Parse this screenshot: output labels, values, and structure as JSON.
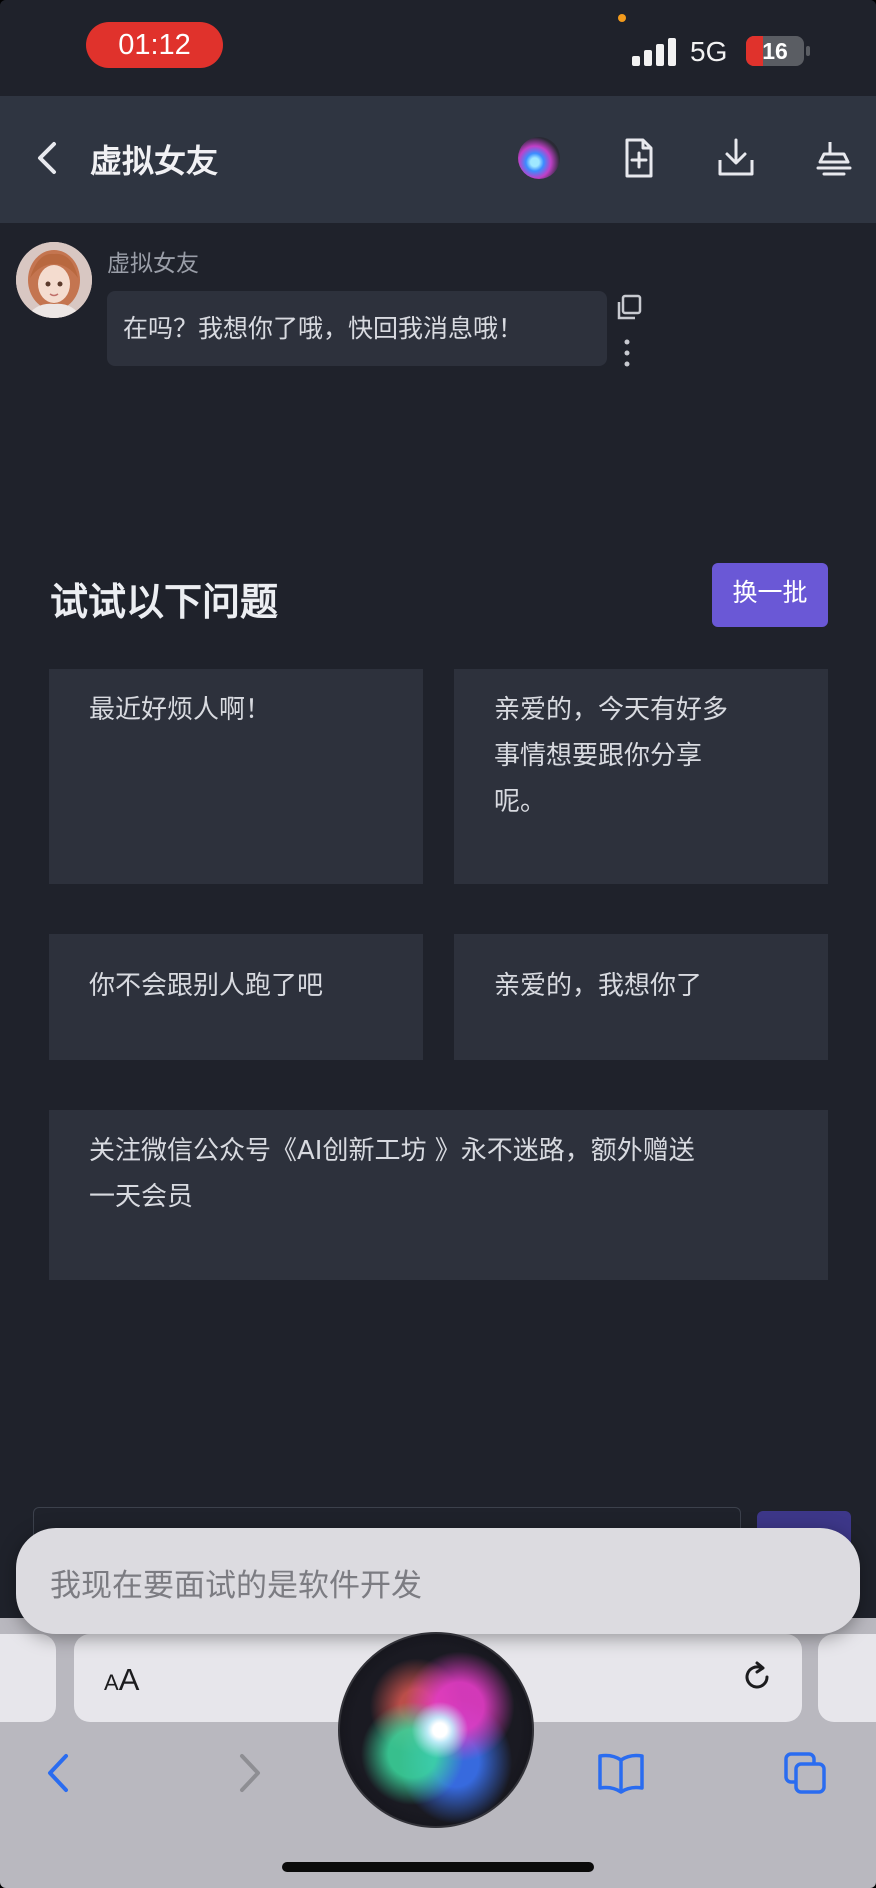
{
  "status_bar": {
    "time": "01:12",
    "network": "5G",
    "battery": "16",
    "battery_level_percent": 16,
    "recording_indicator_color": "#f29a1c"
  },
  "header": {
    "title": "虚拟女友",
    "icons": [
      "back-arrow-icon",
      "siri-icon",
      "new-file-icon",
      "download-icon",
      "clear-icon"
    ]
  },
  "chat": {
    "messages": [
      {
        "sender": "虚拟女友",
        "text": "在吗？我想你了哦，快回我消息哦！",
        "icons": [
          "copy-icon",
          "more-vertical-icon"
        ]
      }
    ]
  },
  "suggestions": {
    "title": "试试以下问题",
    "refresh_label": "换一批",
    "items": [
      "最近好烦人啊！",
      "亲爱的，今天有好多事情想要跟你分享呢。",
      "你不会跟别人跑了吧",
      "亲爱的，我想你了",
      "关注微信公众号《AI创新工坊 》永不迷路，额外赠送一天会员"
    ],
    "item_lines": [
      [
        "最近好烦人啊！"
      ],
      [
        "亲爱的，今天有好多",
        "事情想要跟你分享",
        "呢。"
      ],
      [
        "你不会跟别人跑了吧"
      ],
      [
        "亲爱的，我想你了"
      ],
      [
        "关注微信公众号《AI创新工坊 》永不迷路，额外赠送",
        "一天会员"
      ]
    ]
  },
  "siri": {
    "transcript": "我现在要面试的是软件开发"
  },
  "safari": {
    "aa_small": "A",
    "aa_large": "A",
    "toolbar_icons": [
      "back-icon",
      "forward-icon",
      "bookmarks-icon",
      "tabs-icon"
    ]
  },
  "colors": {
    "background": "#1f222b",
    "header": "#2f3541",
    "card": "#2d313c",
    "accent": "#6a58d6",
    "status_red": "#e0322c"
  }
}
